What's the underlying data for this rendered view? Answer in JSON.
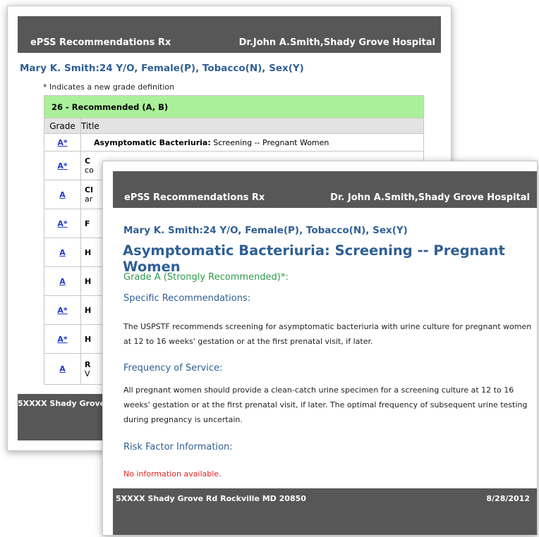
{
  "back_window": {
    "header": {
      "app_title": "ePSS Recommendations Rx",
      "doctor": "Dr.John A.Smith,Shady Grove Hospital"
    },
    "patient": "Mary K. Smith:24 Y/O, Female(P), Tobacco(N), Sex(Y)",
    "note": "* Indicates a new grade definition",
    "table": {
      "group": "26 - Recommended (A, B)",
      "columns": [
        "Grade",
        "Title"
      ],
      "rows": [
        {
          "grade": "A*",
          "title_bold": "Asymptomatic Bacteriuria:",
          "title_rest": " Screening -- Pregnant Women"
        },
        {
          "grade": "A*",
          "title_bold": "C",
          "title_rest": "",
          "title_line2": "co"
        },
        {
          "grade": "A",
          "title_bold": "Cl",
          "title_rest": "",
          "title_line2": "ar"
        },
        {
          "grade": "A*",
          "title_bold": "F",
          "title_rest": ""
        },
        {
          "grade": "A",
          "title_bold": "H",
          "title_rest": ""
        },
        {
          "grade": "A",
          "title_bold": "H",
          "title_rest": ""
        },
        {
          "grade": "A*",
          "title_bold": "H",
          "title_rest": ""
        },
        {
          "grade": "A*",
          "title_bold": "H",
          "title_rest": ""
        },
        {
          "grade": "A",
          "title_bold": "R",
          "title_rest": "",
          "title_line2": "V"
        }
      ]
    },
    "footer": {
      "address": "5XXXX Shady Grove"
    }
  },
  "front_window": {
    "header": {
      "app_title": "ePSS Recommendations Rx",
      "doctor": "Dr. John A.Smith,Shady Grove Hospital"
    },
    "patient": "Mary K. Smith:24 Y/O, Female(P), Tobacco(N), Sex(Y)",
    "title": "Asymptomatic Bacteriuria: Screening -- Pregnant Women",
    "grade": "Grade A (Strongly Recommended)*:",
    "specific_heading": "Specific Recommendations:",
    "specific_text": "The USPSTF recommends screening for asymptomatic bacteriuria with urine culture for pregnant women at 12 to 16 weeks' gestation or at the first prenatal visit, if later.",
    "frequency_heading": "Frequency of Service:",
    "frequency_text": "All pregnant women should provide a clean-catch urine specimen for a screening culture at 12 to 16 weeks' gestation or at the first prenatal visit, if later. The optimal frequency of subsequent urine testing during pregnancy is uncertain.",
    "risk_heading": "Risk Factor Information:",
    "risk_text": "No information available.",
    "footer": {
      "address": "5XXXX Shady Grove Rd Rockville MD 20850",
      "date": "8/28/2012"
    }
  },
  "colors": {
    "header_bg": "#575757",
    "accent_blue": "#2f5f94",
    "grade_green": "#2e9a49",
    "group_bg": "#aaf09a",
    "link": "#1f39c9",
    "alert": "#e32222"
  }
}
